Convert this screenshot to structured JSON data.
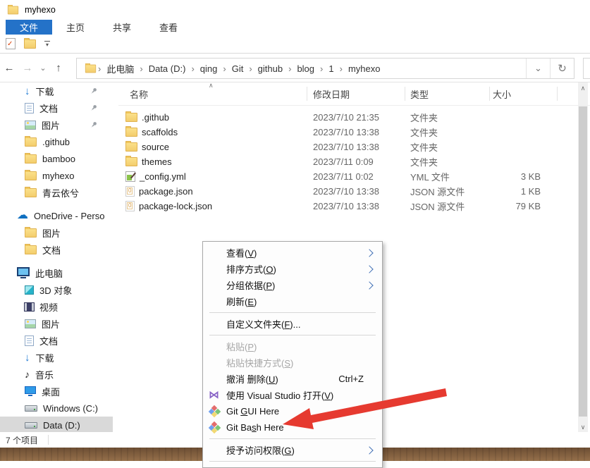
{
  "window": {
    "title": "myhexo"
  },
  "ribbon": {
    "tabs": [
      {
        "id": "file",
        "label": "文件",
        "active": true
      },
      {
        "id": "home",
        "label": "主页",
        "active": false
      },
      {
        "id": "share",
        "label": "共享",
        "active": false
      },
      {
        "id": "view",
        "label": "查看",
        "active": false
      }
    ]
  },
  "icons": {
    "back": "←",
    "forward": "→",
    "dropdown": "⌄",
    "up": "↑",
    "crumb_sep": "›",
    "address_chevron": "⌄",
    "refresh": "↻",
    "sort_asc": "∧",
    "scroll_up": "∧",
    "scroll_down": "∨",
    "qat_dropdown": "▾",
    "cloud": "☁",
    "music": "♪",
    "down_arrow": "↓",
    "vs": "⋈"
  },
  "colors": {
    "active_tab": "#2472c8",
    "selection_gray": "#d9d9d9",
    "git_red": "#e36c6c",
    "git_blue": "#6f9ff0",
    "git_green": "#7cc576",
    "git_yellow": "#f2d974",
    "vs_purple": "#8661c5",
    "annotation_red": "#e63a30"
  },
  "address": {
    "crumbs": [
      "此电脑",
      "Data (D:)",
      "qing",
      "Git",
      "github",
      "blog",
      "1",
      "myhexo"
    ]
  },
  "list": {
    "columns": [
      {
        "id": "name",
        "label": "名称"
      },
      {
        "id": "date",
        "label": "修改日期"
      },
      {
        "id": "type",
        "label": "类型"
      },
      {
        "id": "size",
        "label": "大小"
      }
    ],
    "files": [
      {
        "name": ".github",
        "icon": "folder",
        "date": "2023/7/10 21:35",
        "type": "文件夹",
        "size": ""
      },
      {
        "name": "scaffolds",
        "icon": "folder",
        "date": "2023/7/10 13:38",
        "type": "文件夹",
        "size": ""
      },
      {
        "name": "source",
        "icon": "folder",
        "date": "2023/7/10 13:38",
        "type": "文件夹",
        "size": ""
      },
      {
        "name": "themes",
        "icon": "folder",
        "date": "2023/7/11 0:09",
        "type": "文件夹",
        "size": ""
      },
      {
        "name": "_config.yml",
        "icon": "yml",
        "date": "2023/7/11 0:02",
        "type": "YML 文件",
        "size": "3 KB"
      },
      {
        "name": "package.json",
        "icon": "json",
        "date": "2023/7/10 13:38",
        "type": "JSON 源文件",
        "size": "1 KB"
      },
      {
        "name": "package-lock.json",
        "icon": "json",
        "date": "2023/7/10 13:38",
        "type": "JSON 源文件",
        "size": "79 KB"
      }
    ]
  },
  "sidebar": {
    "items": [
      {
        "id": "qa-downloads",
        "label": "下载",
        "icon": "down",
        "level": 2,
        "pinned": true
      },
      {
        "id": "qa-documents",
        "label": "文档",
        "icon": "doc",
        "level": 2,
        "pinned": true
      },
      {
        "id": "qa-pictures",
        "label": "图片",
        "icon": "pic",
        "level": 2,
        "pinned": true
      },
      {
        "id": "qa-github",
        "label": ".github",
        "icon": "folder",
        "level": 2
      },
      {
        "id": "qa-bamboo",
        "label": "bamboo",
        "icon": "folder",
        "level": 2
      },
      {
        "id": "qa-myhexo",
        "label": "myhexo",
        "icon": "folder",
        "level": 2
      },
      {
        "id": "qa-qingyun",
        "label": "青云依兮",
        "icon": "folder",
        "level": 2
      },
      {
        "id": "onedrive",
        "label": "OneDrive - Perso",
        "icon": "cloud",
        "level": 1,
        "gap": true
      },
      {
        "id": "od-pictures",
        "label": "图片",
        "icon": "folder",
        "level": 2
      },
      {
        "id": "od-documents",
        "label": "文档",
        "icon": "folder",
        "level": 2
      },
      {
        "id": "this-pc",
        "label": "此电脑",
        "icon": "monitor",
        "level": 1,
        "gap": true
      },
      {
        "id": "3d-objects",
        "label": "3D 对象",
        "icon": "cube",
        "level": 2
      },
      {
        "id": "videos",
        "label": "视频",
        "icon": "film",
        "level": 2
      },
      {
        "id": "pc-pictures",
        "label": "图片",
        "icon": "pic",
        "level": 2
      },
      {
        "id": "pc-documents",
        "label": "文档",
        "icon": "doc",
        "level": 2
      },
      {
        "id": "pc-downloads",
        "label": "下载",
        "icon": "down",
        "level": 2
      },
      {
        "id": "music",
        "label": "音乐",
        "icon": "music",
        "level": 2
      },
      {
        "id": "desktop",
        "label": "桌面",
        "icon": "desk",
        "level": 2
      },
      {
        "id": "windows-c",
        "label": "Windows (C:)",
        "icon": "drive",
        "level": 2
      },
      {
        "id": "data-d",
        "label": "Data (D:)",
        "icon": "drive",
        "level": 2,
        "selected": true
      }
    ]
  },
  "statusbar": {
    "items_count": "7 个项目"
  },
  "context_menu": {
    "items": [
      {
        "id": "view",
        "label": "查看(V)",
        "u": 3,
        "submenu": true
      },
      {
        "id": "sort-by",
        "label": "排序方式(O)",
        "u": 5,
        "submenu": true
      },
      {
        "id": "group-by",
        "label": "分组依据(P)",
        "u": 5,
        "submenu": true
      },
      {
        "id": "refresh",
        "label": "刷新(E)",
        "u": 3
      },
      {
        "sep": true
      },
      {
        "id": "customize-folder",
        "label": "自定义文件夹(F)...",
        "u": 7
      },
      {
        "sep": true
      },
      {
        "id": "paste",
        "label": "粘贴(P)",
        "u": 3,
        "disabled": true
      },
      {
        "id": "paste-shortcut",
        "label": "粘贴快捷方式(S)",
        "u": 7,
        "disabled": true
      },
      {
        "id": "undo-delete",
        "label": "撤消 删除(U)",
        "u": 6,
        "shortcut": "Ctrl+Z"
      },
      {
        "id": "open-visual-studio",
        "label": "使用 Visual Studio 打开(V)",
        "u": 20,
        "icon": "vs"
      },
      {
        "id": "git-gui-here",
        "label": "Git GUI Here",
        "u": 4,
        "icon": "git"
      },
      {
        "id": "git-bash-here",
        "label": "Git Bash Here",
        "u": 6,
        "icon": "git"
      },
      {
        "sep": true
      },
      {
        "id": "grant-access",
        "label": "授予访问权限(G)",
        "u": 7,
        "submenu": true
      },
      {
        "sep": true
      }
    ]
  }
}
